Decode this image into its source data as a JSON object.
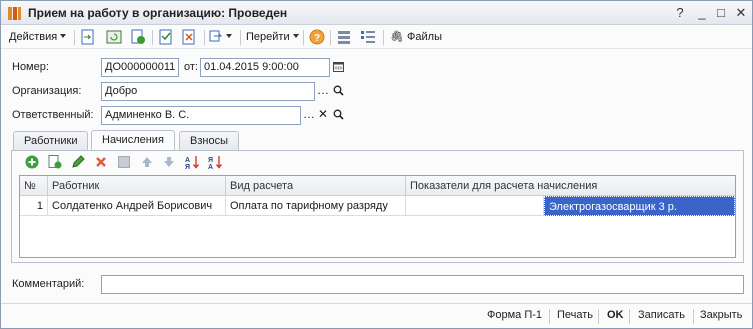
{
  "window": {
    "title": "Прием на работу в организацию: Проведен"
  },
  "toolbar": {
    "actions_label": "Действия",
    "goto_label": "Перейти",
    "files_label": "Файлы"
  },
  "form": {
    "number_label": "Номер:",
    "number_value": "ДО000000011",
    "date_label": "от:",
    "date_value": "01.04.2015  9:00:00",
    "org_label": "Организация:",
    "org_value": "Добро",
    "resp_label": "Ответственный:",
    "resp_value": "Админенко В. С.",
    "comment_label": "Комментарий:",
    "comment_value": ""
  },
  "tabs": [
    {
      "label": "Работники"
    },
    {
      "label": "Начисления"
    },
    {
      "label": "Взносы"
    }
  ],
  "active_tab": "Начисления",
  "grid": {
    "headers": [
      "№",
      "Работник",
      "Вид расчета",
      "Показатели для расчета начисления"
    ],
    "rows": [
      {
        "num": "1",
        "worker": "Солдатенко Андрей Борисович",
        "calc": "Оплата по тарифному разряду",
        "ind1": "",
        "ind2": "Электрогазосварщик 3 р."
      }
    ]
  },
  "bottom": {
    "form_label": "Форма П-1",
    "print_label": "Печать",
    "ok_label": "OK",
    "save_label": "Записать",
    "close_label": "Закрыть"
  }
}
